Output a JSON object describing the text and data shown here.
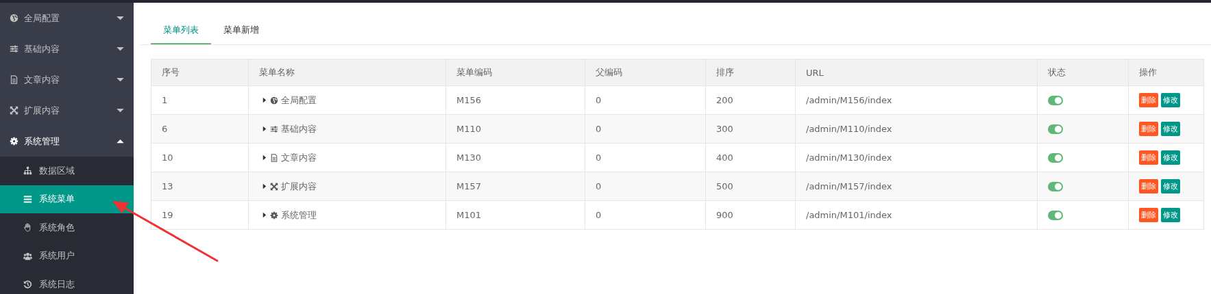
{
  "sidebar": {
    "items": [
      {
        "label": "全局配置",
        "expanded": false,
        "selected": false
      },
      {
        "label": "基础内容",
        "expanded": false,
        "selected": false
      },
      {
        "label": "文章内容",
        "expanded": false,
        "selected": false
      },
      {
        "label": "扩展内容",
        "expanded": false,
        "selected": false
      },
      {
        "label": "系统管理",
        "expanded": true,
        "selected": false,
        "children": [
          {
            "label": "数据区域",
            "selected": false
          },
          {
            "label": "系统菜单",
            "selected": true
          },
          {
            "label": "系统角色",
            "selected": false
          },
          {
            "label": "系统用户",
            "selected": false
          },
          {
            "label": "系统日志",
            "selected": false
          }
        ]
      }
    ]
  },
  "tabs": [
    {
      "label": "菜单列表",
      "selected": true
    },
    {
      "label": "菜单新增",
      "selected": false
    }
  ],
  "table": {
    "columns": [
      "序号",
      "菜单名称",
      "菜单编码",
      "父编码",
      "排序",
      "URL",
      "状态",
      "操作"
    ],
    "rows": [
      {
        "index": "1",
        "name": "全局配置",
        "expanded": false,
        "code": "M156",
        "parent": "0",
        "sort": "200",
        "url": "/admin/M156/index",
        "on": true,
        "actions": [
          "删除",
          "修改"
        ]
      },
      {
        "index": "6",
        "name": "基础内容",
        "expanded": false,
        "code": "M110",
        "parent": "0",
        "sort": "300",
        "url": "/admin/M110/index",
        "on": true,
        "actions": [
          "删除",
          "修改"
        ]
      },
      {
        "index": "10",
        "name": "文章内容",
        "expanded": false,
        "code": "M130",
        "parent": "0",
        "sort": "400",
        "url": "/admin/M130/index",
        "on": true,
        "actions": [
          "删除",
          "修改"
        ]
      },
      {
        "index": "13",
        "name": "扩展内容",
        "expanded": false,
        "code": "M157",
        "parent": "0",
        "sort": "500",
        "url": "/admin/M157/index",
        "on": true,
        "actions": [
          "删除",
          "修改"
        ]
      },
      {
        "index": "19",
        "name": "系统管理",
        "expanded": false,
        "code": "M101",
        "parent": "0",
        "sort": "900",
        "url": "/admin/M101/index",
        "on": true,
        "actions": [
          "删除",
          "修改"
        ]
      }
    ]
  }
}
